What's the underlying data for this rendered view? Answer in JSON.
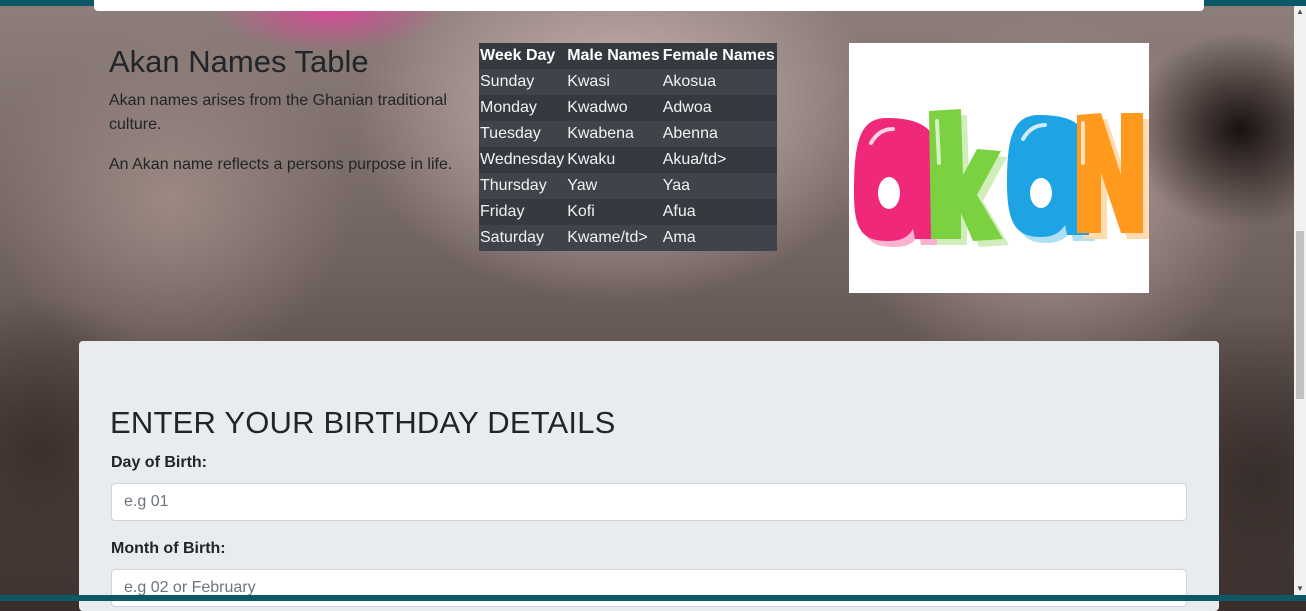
{
  "section": {
    "title": "Akan Names Table",
    "paragraphs": [
      "Akan names arises from the Ghanian traditional culture.",
      "An Akan name reflects a persons purpose in life."
    ]
  },
  "table": {
    "headers": [
      "Week Day",
      "Male Names",
      "Female Names"
    ],
    "rows": [
      [
        "Sunday",
        "Kwasi",
        "Akosua"
      ],
      [
        "Monday",
        "Kwadwo",
        "Adwoa"
      ],
      [
        "Tuesday",
        "Kwabena",
        "Abenna"
      ],
      [
        "Wednesday",
        "Kwaku",
        "Akua/td>"
      ],
      [
        "Thursday",
        "Yaw",
        "Yaa"
      ],
      [
        "Friday",
        "Kofi",
        "Afua"
      ],
      [
        "Saturday",
        "Kwame/td>",
        "Ama"
      ]
    ]
  },
  "logo": {
    "text": "akan",
    "colors": {
      "a1": "#f0287a",
      "k": "#7bd13f",
      "a2": "#1ea4e4",
      "n": "#ff9a1f"
    }
  },
  "form": {
    "heading": "ENTER YOUR BIRTHDAY DETAILS",
    "day": {
      "label": "Day of Birth:",
      "placeholder": "e.g 01",
      "value": ""
    },
    "month": {
      "label": "Month of Birth:",
      "placeholder": "e.g 02 or February",
      "value": ""
    }
  },
  "colors": {
    "accent_bar": "#0d5866",
    "table_bg": "#343a40",
    "form_card_bg": "#e9ecef"
  }
}
